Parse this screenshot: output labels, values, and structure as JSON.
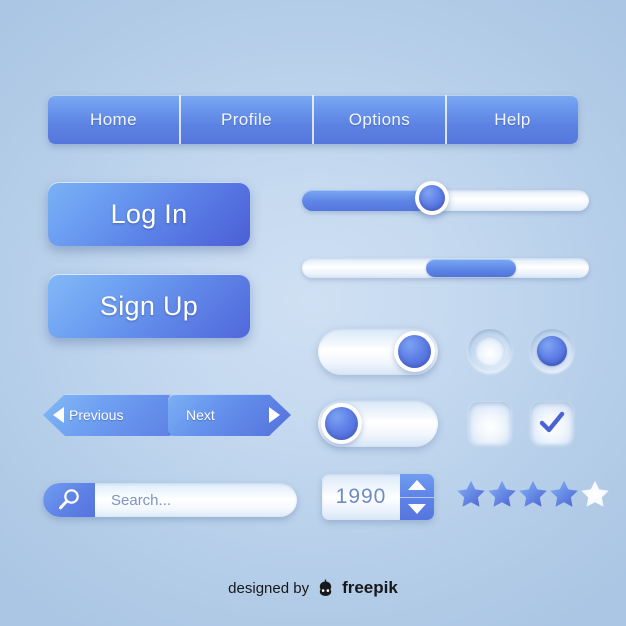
{
  "theme": {
    "background_top": "#b3cde8",
    "background_center": "#cfe0f3",
    "accent_blue": "#5d80e5",
    "accent_deep": "#4a62d4",
    "accent_light": "#83baf7",
    "surface_white": "#ffffff",
    "text_on_accent": "#f2f7ff",
    "muted_text": "#7a94c4"
  },
  "navbar": {
    "items": [
      {
        "label": "Home"
      },
      {
        "label": "Profile"
      },
      {
        "label": "Options"
      },
      {
        "label": "Help"
      }
    ]
  },
  "auth_buttons": {
    "login_label": "Log In",
    "signup_label": "Sign Up"
  },
  "sliders": [
    {
      "name": "knob-slider",
      "value_percent": 46,
      "fill_percent": 46,
      "style": "knob"
    },
    {
      "name": "scroll-slider",
      "value_percent": 49,
      "thumb_width_percent": 31,
      "style": "scrollbar"
    }
  ],
  "toggles": [
    {
      "name": "toggle-on",
      "state": "on",
      "knob_side": "right"
    },
    {
      "name": "toggle-off",
      "state": "off",
      "knob_side": "left"
    }
  ],
  "radios": [
    {
      "name": "radio-unselected",
      "state": "off"
    },
    {
      "name": "radio-selected",
      "state": "on"
    }
  ],
  "checkboxes": [
    {
      "name": "checkbox-unchecked",
      "state": "off",
      "glyph": ""
    },
    {
      "name": "checkbox-checked",
      "state": "on",
      "glyph": "check-icon"
    }
  ],
  "pager": {
    "previous_label": "Previous",
    "next_label": "Next",
    "previous_icon": "triangle-left-icon",
    "next_icon": "triangle-right-icon"
  },
  "search": {
    "placeholder": "Search...",
    "value": "",
    "icon": "search-icon"
  },
  "stepper": {
    "value": "1990",
    "up_icon": "caret-up-icon",
    "down_icon": "caret-down-icon"
  },
  "rating": {
    "max": 5,
    "value": 4,
    "stars": [
      {
        "filled": true
      },
      {
        "filled": true
      },
      {
        "filled": true
      },
      {
        "filled": true
      },
      {
        "filled": false
      }
    ]
  },
  "footer": {
    "prefix": "designed by",
    "brand": "freepik",
    "logo": "freepik-logo-icon"
  }
}
